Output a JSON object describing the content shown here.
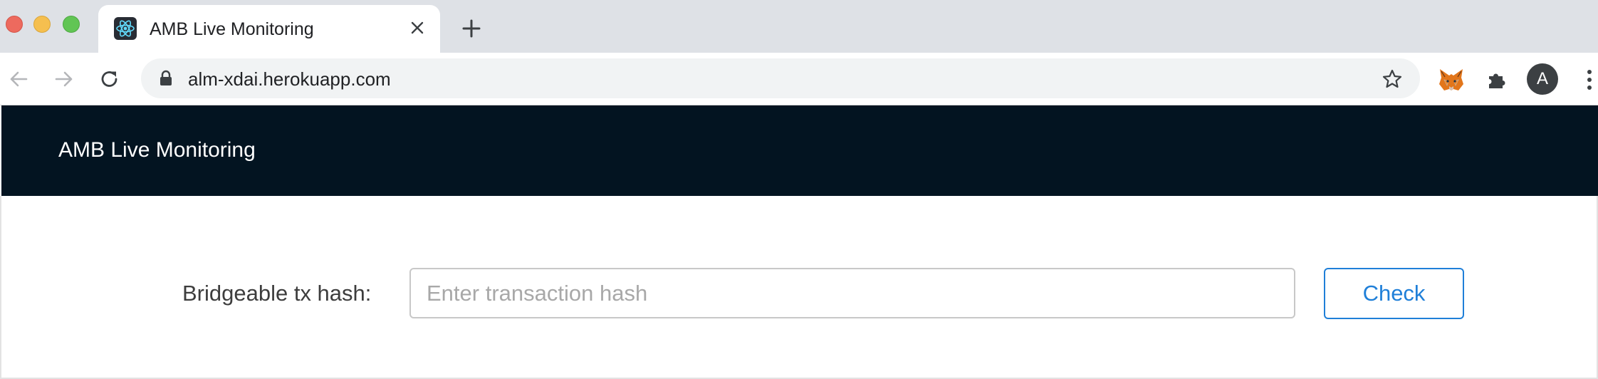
{
  "browser": {
    "tab": {
      "title": "AMB Live Monitoring",
      "favicon": "react-logo-icon"
    },
    "new_tab_icon": "plus-icon",
    "address_bar": {
      "url": "alm-xdai.herokuapp.com",
      "secure_icon": "lock-icon"
    },
    "extensions": [
      "metamask-fox-icon",
      "puzzle-extensions-icon"
    ],
    "profile_initial": "A",
    "colors": {
      "tabbar": "#dee1e6",
      "toolbar": "#ffffff",
      "omnibox": "#f1f3f4"
    }
  },
  "app": {
    "header_title": "AMB Live Monitoring",
    "header_bg": "#031421"
  },
  "form": {
    "label": "Bridgeable tx hash:",
    "input_value": "",
    "input_placeholder": "Enter transaction hash",
    "button_label": "Check",
    "button_color": "#1f7fd8"
  }
}
